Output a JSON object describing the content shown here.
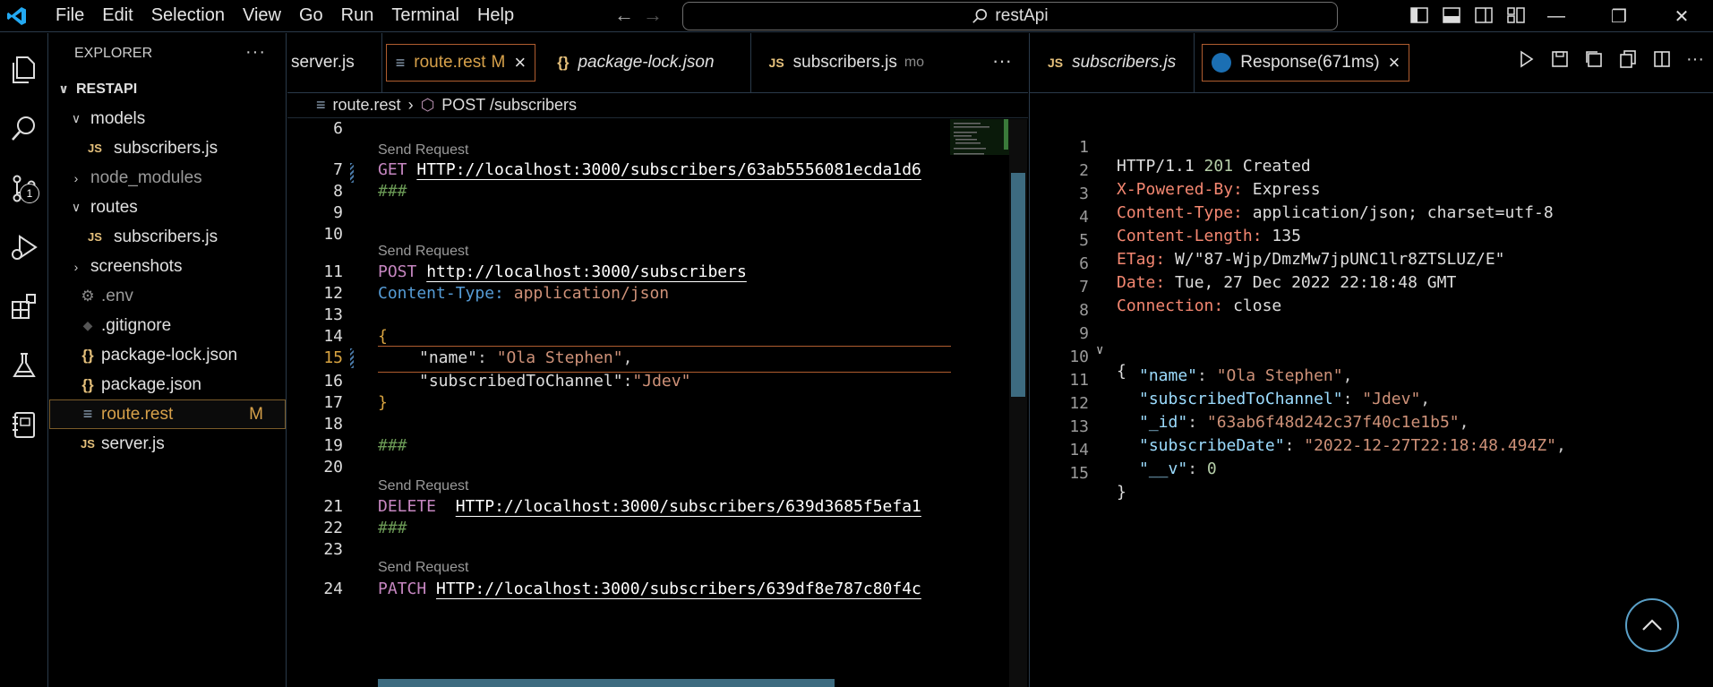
{
  "titlebar": {
    "menu": [
      "File",
      "Edit",
      "Selection",
      "View",
      "Go",
      "Run",
      "Terminal",
      "Help"
    ],
    "search": "restApi",
    "accent": "#23a9f2"
  },
  "activity": {
    "items": [
      "explorer-icon",
      "search-icon",
      "source-control-icon",
      "run-debug-icon",
      "extensions-icon",
      "testing-icon",
      "notebook-icon"
    ],
    "scm_badge": "1"
  },
  "sidebar": {
    "title": "EXPLORER",
    "project": "RESTAPI",
    "items": [
      {
        "label": "models",
        "type": "folder-open"
      },
      {
        "label": "subscribers.js",
        "type": "js"
      },
      {
        "label": "node_modules",
        "type": "folder-closed"
      },
      {
        "label": "routes",
        "type": "folder-open"
      },
      {
        "label": "subscribers.js",
        "type": "js"
      },
      {
        "label": "screenshots",
        "type": "folder-closed"
      },
      {
        "label": ".env",
        "type": "gear"
      },
      {
        "label": ".gitignore",
        "type": "git"
      },
      {
        "label": "package-lock.json",
        "type": "json"
      },
      {
        "label": "package.json",
        "type": "json"
      },
      {
        "label": "route.rest",
        "type": "rest",
        "status": "M"
      },
      {
        "label": "server.js",
        "type": "js"
      }
    ]
  },
  "left_editor": {
    "tabs": [
      {
        "label": "server.js"
      },
      {
        "label": "route.rest",
        "status": "M"
      },
      {
        "label": "package-lock.json"
      },
      {
        "label": "subscribers.js",
        "suffix": "mo"
      }
    ],
    "breadcrumb": {
      "file": "route.rest",
      "symbol": "POST /subscribers"
    },
    "codelens": "Send Request",
    "lines": {
      "l6": "6",
      "l7": "7",
      "l8": "8",
      "l9": "9",
      "l10": "10",
      "l11": "11",
      "l12": "12",
      "l13": "13",
      "l14": "14",
      "l15": "15",
      "l16": "16",
      "l17": "17",
      "l18": "18",
      "l19": "19",
      "l20": "20",
      "l21": "21",
      "l22": "22",
      "l23": "23",
      "l24": "24"
    },
    "code": {
      "get_method": "GET",
      "get_url": "HTTP://localhost:3000/subscribers/63ab5556081ecda1d6",
      "sep": "###",
      "post_method": "POST",
      "post_url": "http://localhost:3000/subscribers",
      "ct_name": "Content-Type:",
      "ct_value": "application/json",
      "open_brace": "{",
      "name_key": "\"name\"",
      "name_colon": ": ",
      "name_value": "\"Ola Stephen\"",
      "comma": ",",
      "sub_key": "\"subscribedToChannel\"",
      "sub_colon": ":",
      "sub_value": "\"Jdev\"",
      "close_brace": "}",
      "delete_method": "DELETE",
      "delete_url": "HTTP://localhost:3000/subscribers/639d3685f5efa1",
      "patch_method": "PATCH",
      "patch_url": "HTTP://localhost:3000/subscribers/639df8e787c80f4c"
    }
  },
  "right_editor": {
    "tabs": [
      {
        "label": "subscribers.js"
      },
      {
        "label": "Response(671ms)"
      }
    ],
    "response": {
      "status_proto": "HTTP/1.1",
      "status_code": "201",
      "status_text": "Created",
      "headers": [
        {
          "name": "X-Powered-By:",
          "value": "Express"
        },
        {
          "name": "Content-Type:",
          "value": "application/json; charset=utf-8"
        },
        {
          "name": "Content-Length:",
          "value": "135"
        },
        {
          "name": "ETag:",
          "value": "W/\"87-Wjp/DmzMw7jpUNC1lr8ZTSLUZ/E\""
        },
        {
          "name": "Date:",
          "value": "Tue, 27 Dec 2022 22:18:48 GMT"
        },
        {
          "name": "Connection:",
          "value": "close"
        }
      ],
      "body": {
        "open": "{",
        "close": "}",
        "fields": [
          {
            "key": "\"name\"",
            "value": "\"Ola Stephen\"",
            "kind": "str"
          },
          {
            "key": "\"subscribedToChannel\"",
            "value": "\"Jdev\"",
            "kind": "str"
          },
          {
            "key": "\"_id\"",
            "value": "\"63ab6f48d242c37f40c1e1b5\"",
            "kind": "str"
          },
          {
            "key": "\"subscribeDate\"",
            "value": "\"2022-12-27T22:18:48.494Z\"",
            "kind": "str"
          },
          {
            "key": "\"__v\"",
            "value": "0",
            "kind": "num"
          }
        ]
      },
      "line_numbers": [
        "1",
        "2",
        "3",
        "4",
        "5",
        "6",
        "7",
        "8",
        "9",
        "10",
        "11",
        "12",
        "13",
        "14",
        "15"
      ]
    }
  }
}
